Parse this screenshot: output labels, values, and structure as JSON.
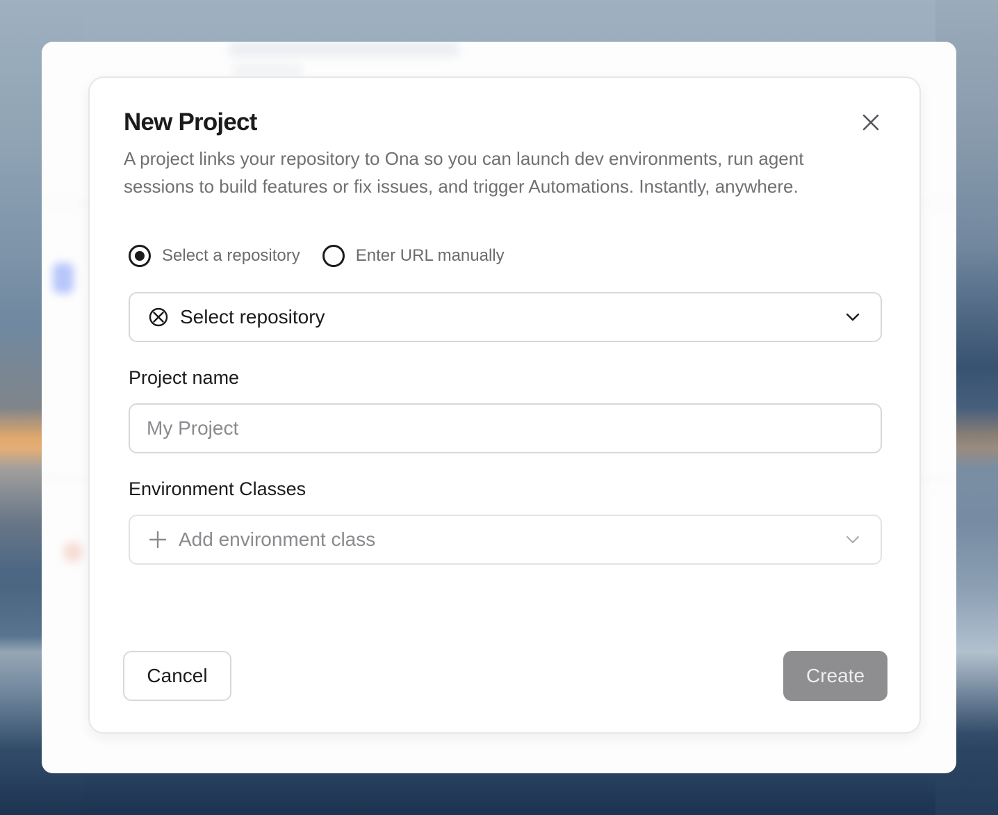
{
  "dialog": {
    "title": "New Project",
    "description": "A project links your repository to Ona so you can launch dev environments, run agent sessions to build features or fix issues, and trigger Automations. Instantly, anywhere.",
    "close_icon": "close-icon"
  },
  "source_options": [
    {
      "label": "Select a repository",
      "selected": true
    },
    {
      "label": "Enter URL manually",
      "selected": false
    }
  ],
  "repository_select": {
    "value": "Select repository",
    "icon": "repository-icon"
  },
  "project_name": {
    "label": "Project name",
    "placeholder": "My Project",
    "value": ""
  },
  "environment_classes": {
    "label": "Environment Classes",
    "placeholder": "Add environment class",
    "icon": "plus-icon"
  },
  "footer": {
    "cancel_label": "Cancel",
    "create_label": "Create",
    "create_disabled": true
  },
  "colors": {
    "text_primary": "#1b1b1d",
    "text_muted": "#707074",
    "border": "#d8d8db",
    "create_bg_disabled": "#8e8e90"
  }
}
